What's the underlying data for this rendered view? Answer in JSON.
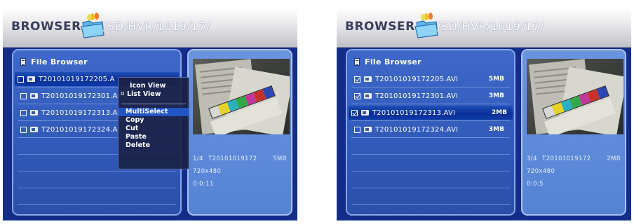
{
  "header": {
    "title": "BROWSER",
    "path": "/SD/HVR/1019/17/"
  },
  "panel_title": "File Browser",
  "left_screen": {
    "files": [
      {
        "name": "T20101019172205.A",
        "checked": false
      },
      {
        "name": "T20101019172301.A",
        "checked": false
      },
      {
        "name": "T20101019172313.A",
        "checked": false
      },
      {
        "name": "T20101019172324.A",
        "checked": false
      }
    ],
    "context_menu": {
      "view_items": [
        "Icon View",
        "List View"
      ],
      "view_selected_marker": "o",
      "edit_items": [
        "MultiSelect",
        "Copy",
        "Cut",
        "Paste",
        "Delete"
      ],
      "highlighted": "MultiSelect"
    },
    "preview": {
      "index": "1/4",
      "name": "T20101019172",
      "size": "5MB",
      "resolution": "720x480",
      "duration": "0:0:11"
    }
  },
  "right_screen": {
    "files": [
      {
        "name": "T20101019172205.AVI",
        "size": "5MB",
        "checked": true
      },
      {
        "name": "T20101019172301.AVI",
        "size": "3MB",
        "checked": true
      },
      {
        "name": "T20101019172313.AVI",
        "size": "2MB",
        "checked": true
      },
      {
        "name": "T20101019172324.AVI",
        "size": "3MB",
        "checked": false
      }
    ],
    "preview": {
      "index": "3/4",
      "name": "T20101019172",
      "size": "2MB",
      "resolution": "720x480",
      "duration": "0:0:5"
    }
  },
  "colors": {
    "background": "#142c8a",
    "panel": "#3159b8",
    "selection": "#0a2f98",
    "menu_highlight": "#2155c4"
  },
  "icons": [
    "folder-icon",
    "document-icon",
    "checkbox-icon",
    "video-file-icon"
  ]
}
